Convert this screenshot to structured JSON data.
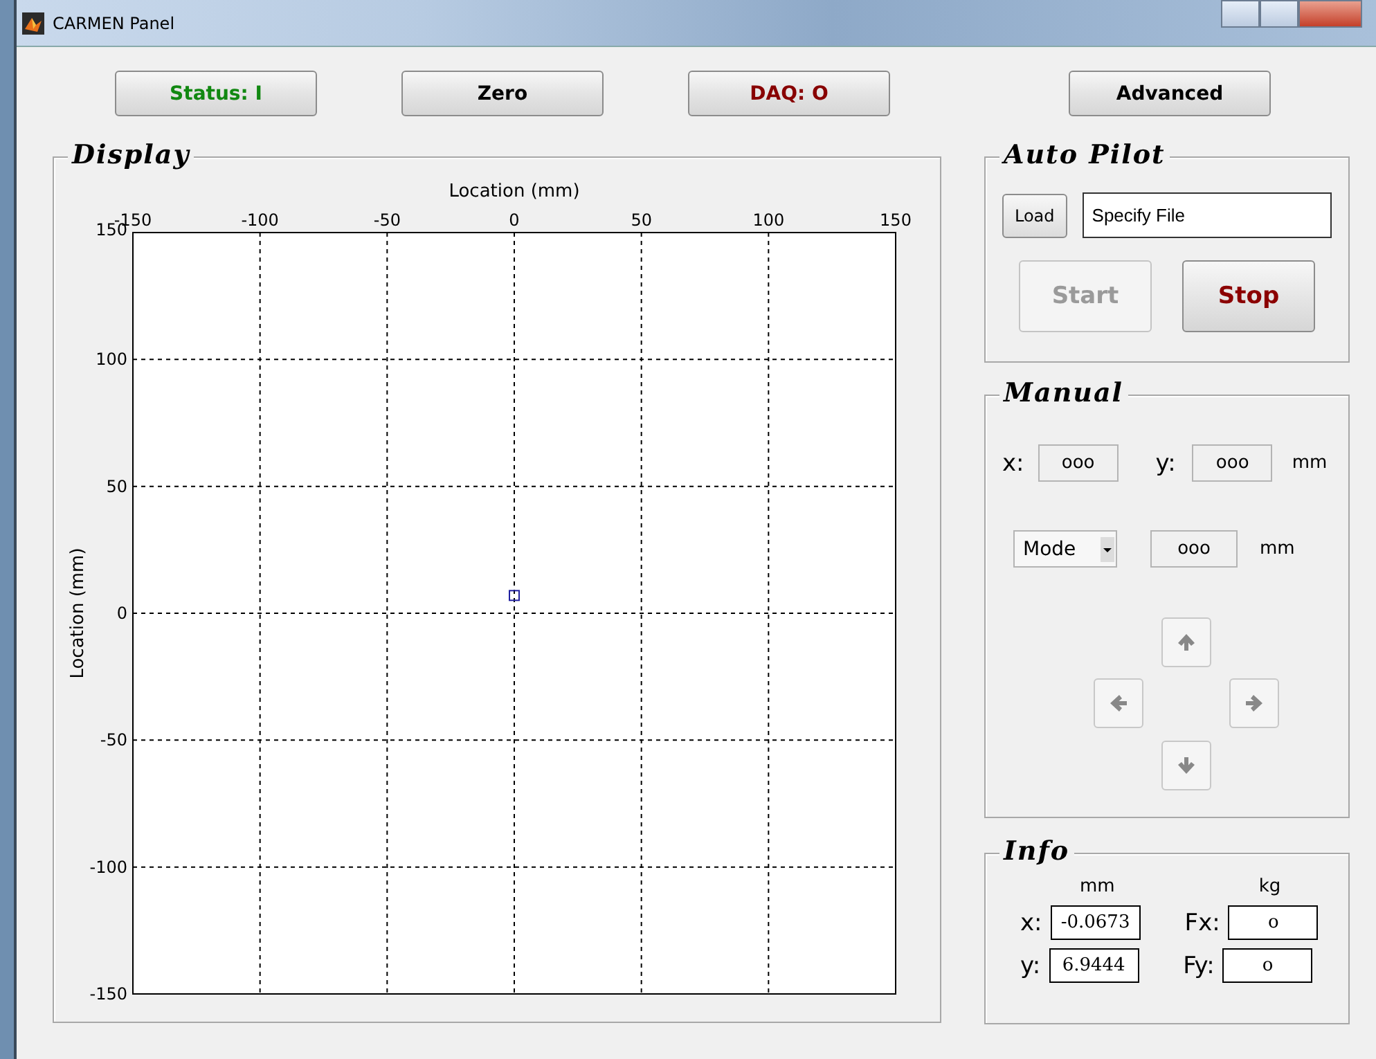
{
  "window": {
    "title": "CARMEN Panel"
  },
  "toolbar": [
    {
      "label": "Status: I",
      "color": "#118811"
    },
    {
      "label": "Zero",
      "color": "#000000"
    },
    {
      "label": "DAQ: O",
      "color": "#880000"
    },
    {
      "label": "Advanced",
      "color": "#000000"
    }
  ],
  "display": {
    "title": "Display",
    "chart_data": {
      "type": "scatter",
      "xlabel": "Location (mm)",
      "ylabel": "Location (mm)",
      "grid": true,
      "x": [
        0
      ],
      "series": [
        {
          "color": "#2020a0",
          "values": [
            7
          ]
        }
      ],
      "xlim": [
        -150,
        150
      ],
      "ylim": [
        -150,
        150
      ],
      "xticks": [
        -150,
        -100,
        -50,
        0,
        50,
        100,
        150
      ],
      "yticks": [
        -150,
        -100,
        -50,
        0,
        50,
        100,
        150
      ]
    }
  },
  "auto_pilot": {
    "title": "Auto Pilot",
    "load_button": "Load",
    "file_field": {
      "value": "Specify File"
    },
    "buttons": [
      {
        "label": "Start",
        "disabled": true
      },
      {
        "label": "Stop",
        "disabled": false
      }
    ]
  },
  "manual": {
    "title": "Manual",
    "x_label": "x:",
    "x_field": {
      "value": "ooo"
    },
    "y_label": "y:",
    "y_field": {
      "value": "ooo"
    },
    "unit": "mm",
    "mode_select": {
      "value": "Mode"
    },
    "step_field": {
      "value": "ooo"
    },
    "step_unit": "mm"
  },
  "info": {
    "title": "Info",
    "columns": [
      "mm",
      "kg"
    ],
    "rows": [
      {
        "label": "x:",
        "value": "-0.0673",
        "force_label": "Fx:",
        "force_value": "o"
      },
      {
        "label": "y:",
        "value": "6.9444",
        "force_label": "Fy:",
        "force_value": "o"
      }
    ]
  }
}
